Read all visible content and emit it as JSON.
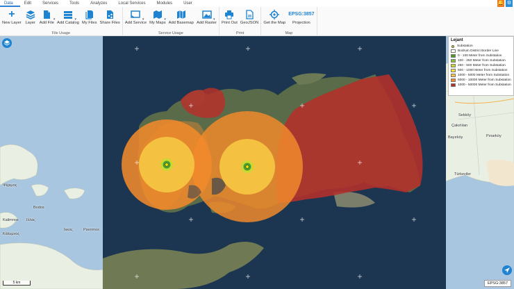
{
  "menu": {
    "items": [
      "Data",
      "Edit",
      "Services",
      "Tools",
      "Analyzes",
      "Local Services",
      "Modules",
      "User"
    ],
    "active": "Data",
    "colors": {
      "bell": "#f07c22",
      "settings": "#2b8fd8"
    }
  },
  "ribbon": {
    "file_usage": {
      "caption": "File Usage",
      "new_layer": "New Layer",
      "layer": "Layer",
      "add_file": "Add File",
      "add_catalog": "Add Catalog",
      "my_files": "My Files",
      "share_files": "Share Files"
    },
    "service_usage": {
      "caption": "Service Usage",
      "add_service": "Add Service",
      "my_maps": "My Maps",
      "add_basemap": "Add Basemap",
      "add_raster": "Add Raster"
    },
    "print": {
      "caption": "Print",
      "print_out": "Print Out",
      "geojson": "GeoJSON"
    },
    "map": {
      "caption": "Map",
      "get_the_map": "Get the Map",
      "epsg": "EPSG:3857",
      "projection": "Projection"
    },
    "accent_color": "#1e83d0"
  },
  "legend": {
    "title": "Lejant",
    "items": [
      {
        "label": "Substation",
        "color": "#f2e600",
        "kind": "dot"
      },
      {
        "label": "Bodrum District Border Line",
        "color": "#ffffff",
        "kind": "box"
      },
      {
        "label": "0 - 100 Meter from Substation",
        "color": "#4c9a2a",
        "kind": "box"
      },
      {
        "label": "100 - 250 Meter from Substation",
        "color": "#8bbf3a",
        "kind": "box"
      },
      {
        "label": "250 - 500 Meter from Substation",
        "color": "#c8d935",
        "kind": "box"
      },
      {
        "label": "500 - 1000 Meter from Substation",
        "color": "#f3e23a",
        "kind": "box"
      },
      {
        "label": "1000 - 5000 Meter from Substation",
        "color": "#f5c441",
        "kind": "box"
      },
      {
        "label": "5000 - 10000 Meter from Substation",
        "color": "#f08a2b",
        "kind": "box"
      },
      {
        "label": "1000 - 50000 Meter from Substation",
        "color": "#b5302a",
        "kind": "box"
      }
    ]
  },
  "map": {
    "places": [
      "Kalimnos",
      "Κάλυμνος",
      "Bodos",
      "Ιλλας",
      "Ικκος",
      "Psenmos",
      "Ψέριμος",
      "Sekköy",
      "Çakırlılan",
      "Bayırköy",
      "Pınarköy",
      "Türkeviler"
    ],
    "scale_label": "5 km",
    "epsg_status": "EPSG:3857",
    "colors": {
      "sea": "#a8c6df",
      "land": "#e8eee2",
      "imagery_sea": "#1f3a55",
      "imagery_land": "#5a6b4a"
    }
  }
}
